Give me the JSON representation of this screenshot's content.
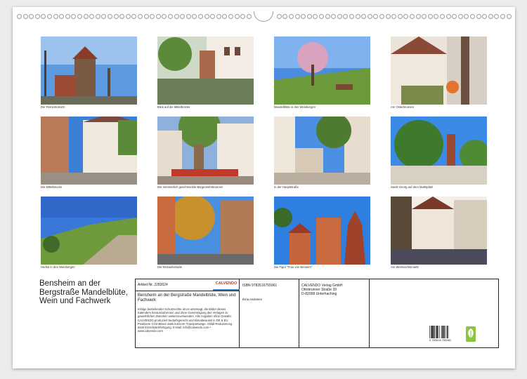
{
  "photos": [
    {
      "caption": "Der Rinnentorturm"
    },
    {
      "caption": "Blick auf die Mittelbrücke"
    },
    {
      "caption": "Mandelblüte in den Weinbergen"
    },
    {
      "caption": "Am Osterbrunnen"
    },
    {
      "caption": "Die Mittelbrücke"
    },
    {
      "caption": "Der sommerlich geschmückte Bürgerwehrbrunnen"
    },
    {
      "caption": "In der Hauptstraße"
    },
    {
      "caption": "Sankt Georg auf dem Marktplatz"
    },
    {
      "caption": "Herbst in den Weinbergen"
    },
    {
      "caption": "Die Einkaufsstraße"
    },
    {
      "caption": "Die Figur \"Frau von Bensem\""
    },
    {
      "caption": "Am Weihnachtsmarkt"
    }
  ],
  "title": "Bensheim an der Bergstraße Mandelblüte, Wein und Fachwerk",
  "info": {
    "article_label": "Artikel-Nr. 2283624",
    "logo_text": "CALVENDO",
    "product_title": "Bensheim an der Bergstraße Mandelblüte, Wein und Fachwerk",
    "legal": "Infolge bestehender Schutzrechte ist es untersagt, die Bilder dieses Kalenders herauszutrennen und ohne Genehmigung des Verlages zu gewerblichen Zwecken weiterzuverwenden. Alle Angaben ohne Gewähr. CALVENDO produziert bedarfsgerecht und klimabewusst in DE & EU. Positivere CO2-Bilanz dank kürzerer Transportwege. Abfall-Reduzierung dank Einzelstückfertigung. E-Mail: info@calvendo.com • www.calvendo.com",
    "isbn": "ISBN 9783516755961",
    "author": "Ilona Andersen",
    "publisher_line1": "CALVENDO Verlag GmbH",
    "publisher_line2": "Ottobrunner Straße 39",
    "publisher_line3": "D-82008 Unterhaching",
    "barcode_number": "9 783516 755961"
  }
}
